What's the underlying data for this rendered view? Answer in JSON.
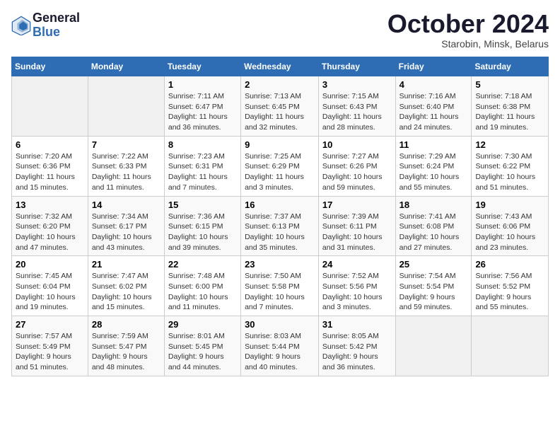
{
  "header": {
    "logo_general": "General",
    "logo_blue": "Blue",
    "month": "October 2024",
    "location": "Starobin, Minsk, Belarus"
  },
  "days_of_week": [
    "Sunday",
    "Monday",
    "Tuesday",
    "Wednesday",
    "Thursday",
    "Friday",
    "Saturday"
  ],
  "weeks": [
    [
      {
        "num": "",
        "info": ""
      },
      {
        "num": "",
        "info": ""
      },
      {
        "num": "1",
        "info": "Sunrise: 7:11 AM\nSunset: 6:47 PM\nDaylight: 11 hours and 36 minutes."
      },
      {
        "num": "2",
        "info": "Sunrise: 7:13 AM\nSunset: 6:45 PM\nDaylight: 11 hours and 32 minutes."
      },
      {
        "num": "3",
        "info": "Sunrise: 7:15 AM\nSunset: 6:43 PM\nDaylight: 11 hours and 28 minutes."
      },
      {
        "num": "4",
        "info": "Sunrise: 7:16 AM\nSunset: 6:40 PM\nDaylight: 11 hours and 24 minutes."
      },
      {
        "num": "5",
        "info": "Sunrise: 7:18 AM\nSunset: 6:38 PM\nDaylight: 11 hours and 19 minutes."
      }
    ],
    [
      {
        "num": "6",
        "info": "Sunrise: 7:20 AM\nSunset: 6:36 PM\nDaylight: 11 hours and 15 minutes."
      },
      {
        "num": "7",
        "info": "Sunrise: 7:22 AM\nSunset: 6:33 PM\nDaylight: 11 hours and 11 minutes."
      },
      {
        "num": "8",
        "info": "Sunrise: 7:23 AM\nSunset: 6:31 PM\nDaylight: 11 hours and 7 minutes."
      },
      {
        "num": "9",
        "info": "Sunrise: 7:25 AM\nSunset: 6:29 PM\nDaylight: 11 hours and 3 minutes."
      },
      {
        "num": "10",
        "info": "Sunrise: 7:27 AM\nSunset: 6:26 PM\nDaylight: 10 hours and 59 minutes."
      },
      {
        "num": "11",
        "info": "Sunrise: 7:29 AM\nSunset: 6:24 PM\nDaylight: 10 hours and 55 minutes."
      },
      {
        "num": "12",
        "info": "Sunrise: 7:30 AM\nSunset: 6:22 PM\nDaylight: 10 hours and 51 minutes."
      }
    ],
    [
      {
        "num": "13",
        "info": "Sunrise: 7:32 AM\nSunset: 6:20 PM\nDaylight: 10 hours and 47 minutes."
      },
      {
        "num": "14",
        "info": "Sunrise: 7:34 AM\nSunset: 6:17 PM\nDaylight: 10 hours and 43 minutes."
      },
      {
        "num": "15",
        "info": "Sunrise: 7:36 AM\nSunset: 6:15 PM\nDaylight: 10 hours and 39 minutes."
      },
      {
        "num": "16",
        "info": "Sunrise: 7:37 AM\nSunset: 6:13 PM\nDaylight: 10 hours and 35 minutes."
      },
      {
        "num": "17",
        "info": "Sunrise: 7:39 AM\nSunset: 6:11 PM\nDaylight: 10 hours and 31 minutes."
      },
      {
        "num": "18",
        "info": "Sunrise: 7:41 AM\nSunset: 6:08 PM\nDaylight: 10 hours and 27 minutes."
      },
      {
        "num": "19",
        "info": "Sunrise: 7:43 AM\nSunset: 6:06 PM\nDaylight: 10 hours and 23 minutes."
      }
    ],
    [
      {
        "num": "20",
        "info": "Sunrise: 7:45 AM\nSunset: 6:04 PM\nDaylight: 10 hours and 19 minutes."
      },
      {
        "num": "21",
        "info": "Sunrise: 7:47 AM\nSunset: 6:02 PM\nDaylight: 10 hours and 15 minutes."
      },
      {
        "num": "22",
        "info": "Sunrise: 7:48 AM\nSunset: 6:00 PM\nDaylight: 10 hours and 11 minutes."
      },
      {
        "num": "23",
        "info": "Sunrise: 7:50 AM\nSunset: 5:58 PM\nDaylight: 10 hours and 7 minutes."
      },
      {
        "num": "24",
        "info": "Sunrise: 7:52 AM\nSunset: 5:56 PM\nDaylight: 10 hours and 3 minutes."
      },
      {
        "num": "25",
        "info": "Sunrise: 7:54 AM\nSunset: 5:54 PM\nDaylight: 9 hours and 59 minutes."
      },
      {
        "num": "26",
        "info": "Sunrise: 7:56 AM\nSunset: 5:52 PM\nDaylight: 9 hours and 55 minutes."
      }
    ],
    [
      {
        "num": "27",
        "info": "Sunrise: 7:57 AM\nSunset: 5:49 PM\nDaylight: 9 hours and 51 minutes."
      },
      {
        "num": "28",
        "info": "Sunrise: 7:59 AM\nSunset: 5:47 PM\nDaylight: 9 hours and 48 minutes."
      },
      {
        "num": "29",
        "info": "Sunrise: 8:01 AM\nSunset: 5:45 PM\nDaylight: 9 hours and 44 minutes."
      },
      {
        "num": "30",
        "info": "Sunrise: 8:03 AM\nSunset: 5:44 PM\nDaylight: 9 hours and 40 minutes."
      },
      {
        "num": "31",
        "info": "Sunrise: 8:05 AM\nSunset: 5:42 PM\nDaylight: 9 hours and 36 minutes."
      },
      {
        "num": "",
        "info": ""
      },
      {
        "num": "",
        "info": ""
      }
    ]
  ]
}
